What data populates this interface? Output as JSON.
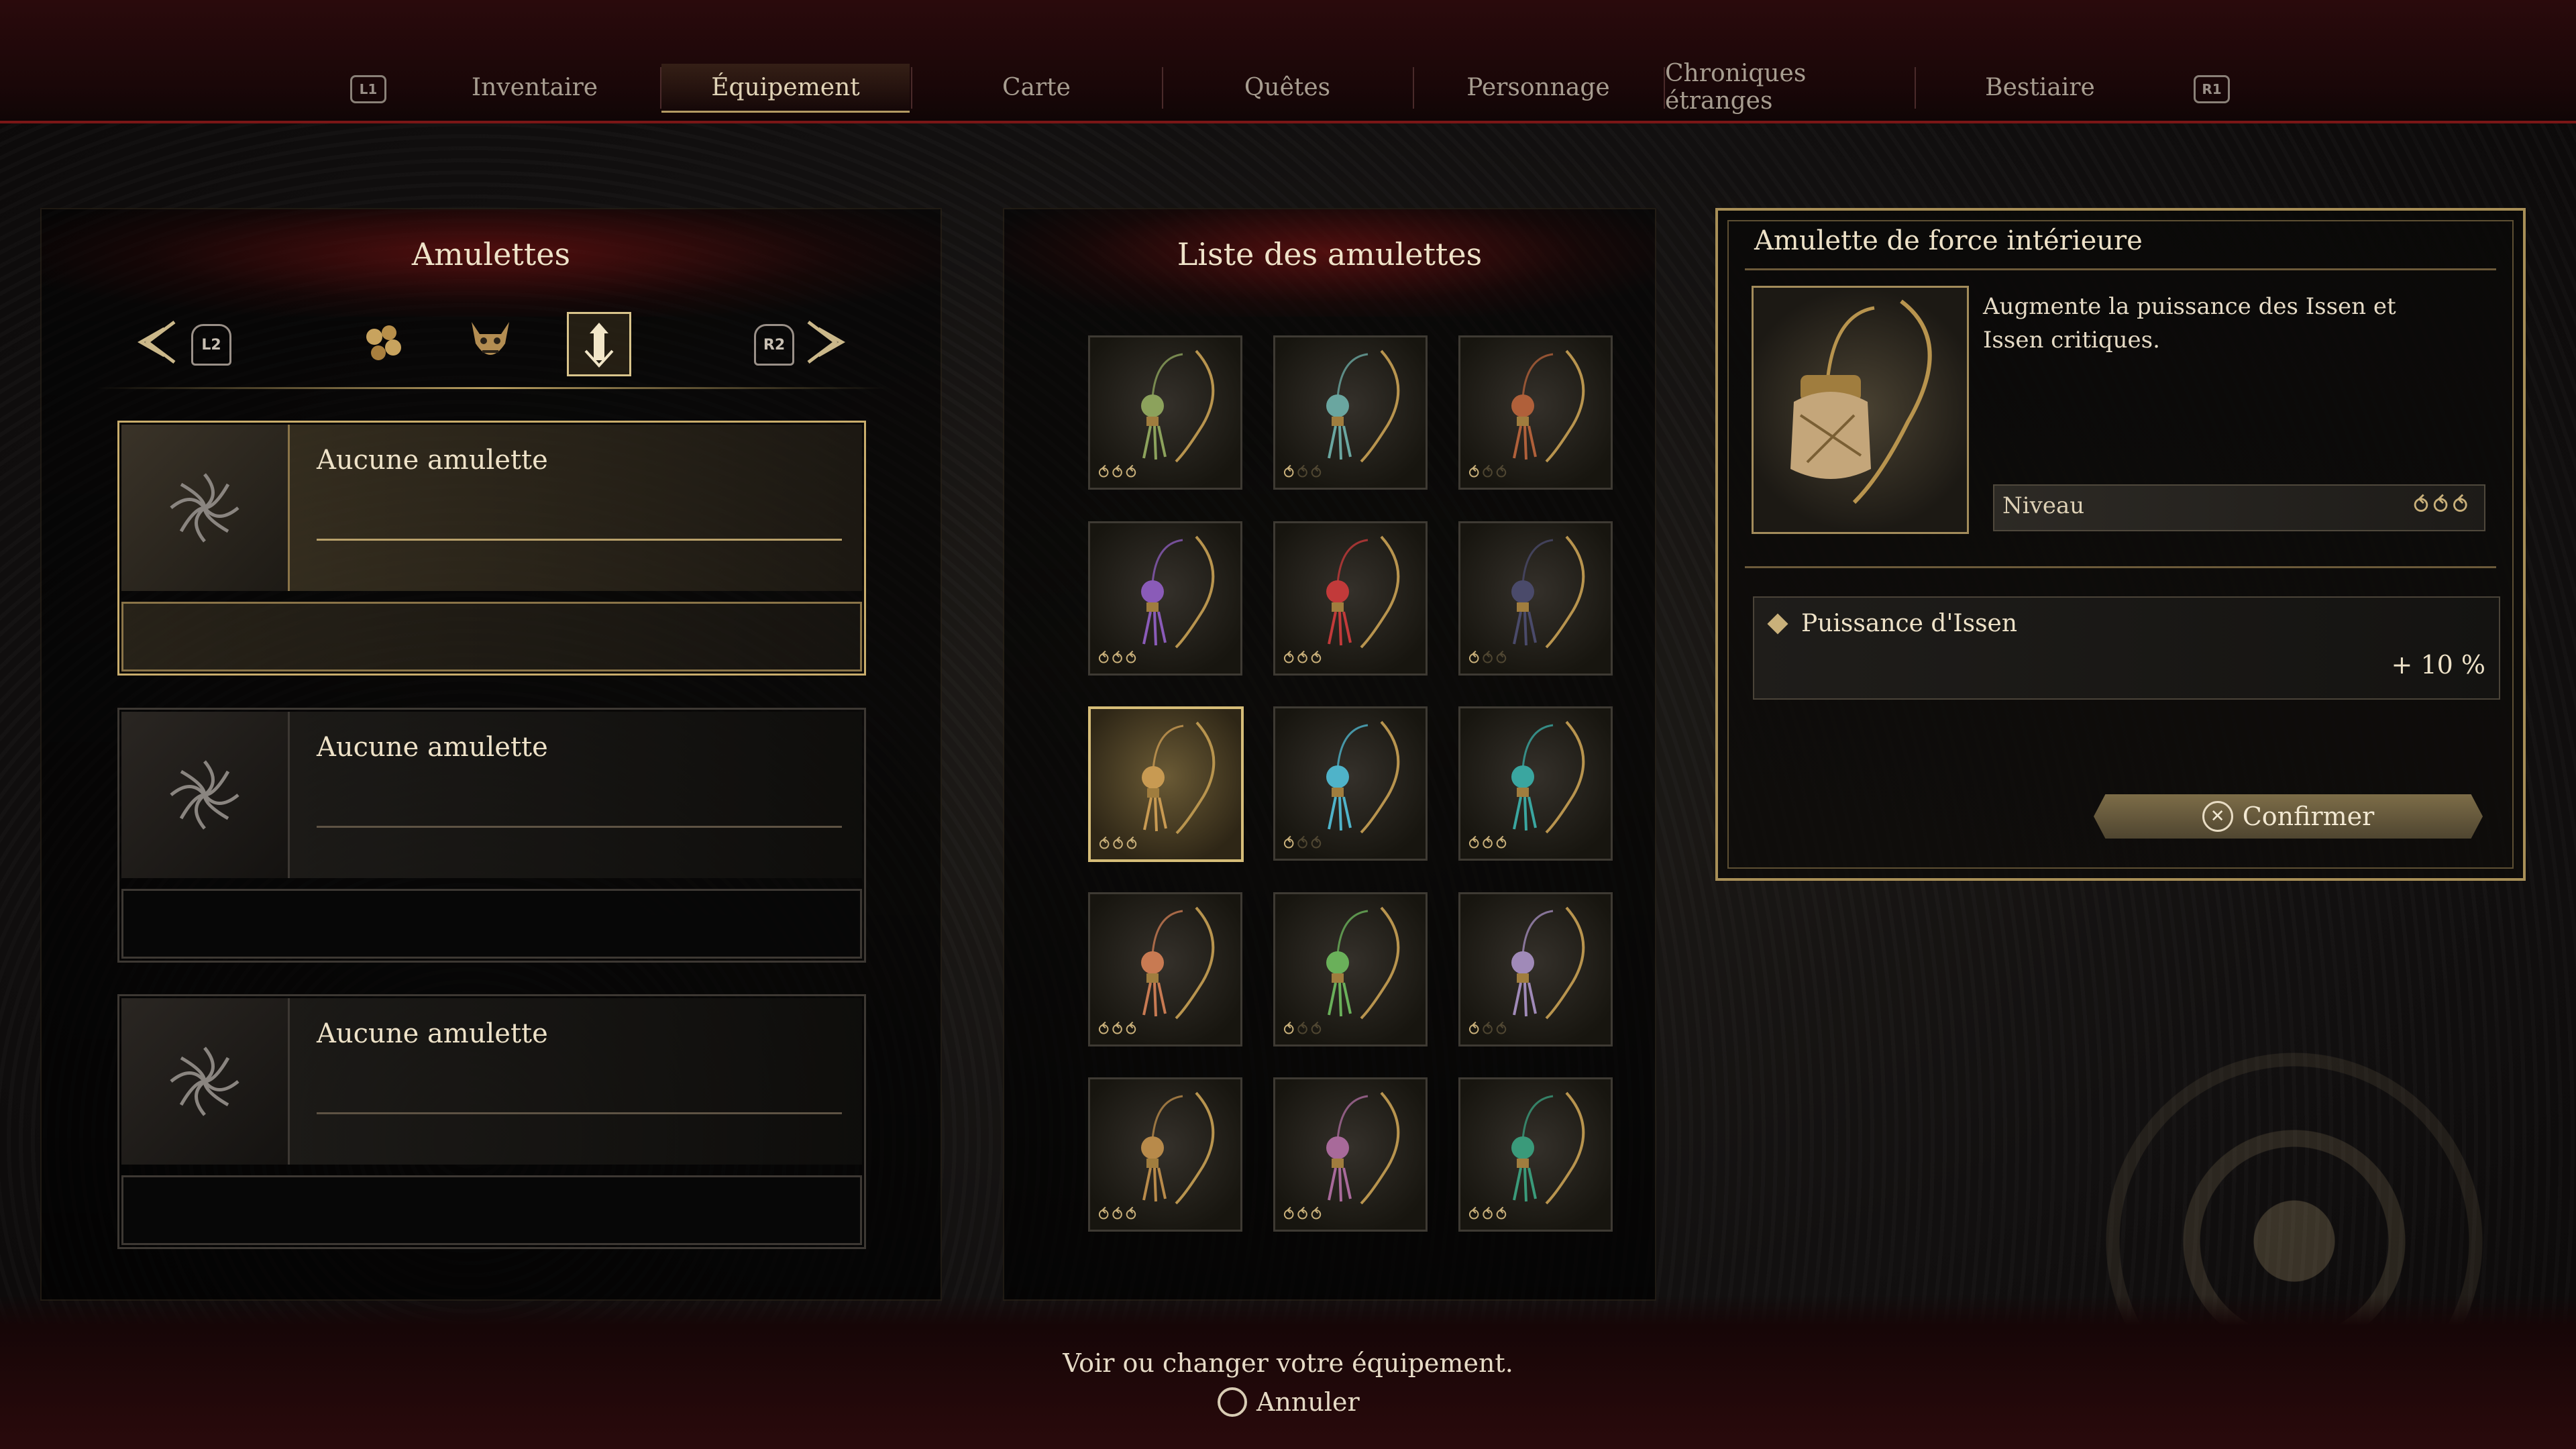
{
  "tabs": {
    "left_shoulder": "L1",
    "right_shoulder": "R1",
    "items": [
      {
        "label": "Inventaire"
      },
      {
        "label": "Équipement"
      },
      {
        "label": "Carte"
      },
      {
        "label": "Quêtes"
      },
      {
        "label": "Personnage"
      },
      {
        "label": "Chroniques étranges"
      },
      {
        "label": "Bestiaire"
      }
    ],
    "active_index": 1
  },
  "left_panel": {
    "title": "Amulettes",
    "prev_trigger": "L2",
    "next_trigger": "R2",
    "category_icons": [
      "beads-icon",
      "oni-mask-icon",
      "amulet-category-icon"
    ],
    "active_category_index": 2,
    "slots": [
      {
        "name": "Aucune amulette",
        "selected": true
      },
      {
        "name": "Aucune amulette",
        "selected": false
      },
      {
        "name": "Aucune amulette",
        "selected": false
      }
    ]
  },
  "center_panel": {
    "title": "Liste des amulettes",
    "selected_index": 6,
    "items": [
      {
        "icon": "amulet-icon",
        "color": "#8ca25c",
        "level": 3
      },
      {
        "icon": "amulet-icon",
        "color": "#6aa6a0",
        "level": 1
      },
      {
        "icon": "amulet-icon",
        "color": "#b0603a",
        "level": 1
      },
      {
        "icon": "amulet-icon",
        "color": "#8a5bb8",
        "level": 3
      },
      {
        "icon": "amulet-icon",
        "color": "#c23a3a",
        "level": 3
      },
      {
        "icon": "amulet-icon",
        "color": "#4a4a6a",
        "level": 1
      },
      {
        "icon": "amulet-icon",
        "color": "#c89a52",
        "level": 3
      },
      {
        "icon": "amulet-icon",
        "color": "#4fb3c9",
        "level": 1
      },
      {
        "icon": "amulet-icon",
        "color": "#3aa6a0",
        "level": 3
      },
      {
        "icon": "amulet-icon",
        "color": "#c87a52",
        "level": 3
      },
      {
        "icon": "amulet-icon",
        "color": "#6ab05a",
        "level": 1
      },
      {
        "icon": "amulet-icon",
        "color": "#a08ab8",
        "level": 1
      },
      {
        "icon": "amulet-icon",
        "color": "#b88a4a",
        "level": 3
      },
      {
        "icon": "amulet-icon",
        "color": "#a86a9a",
        "level": 3
      },
      {
        "icon": "amulet-icon",
        "color": "#3a9a7a",
        "level": 3
      }
    ]
  },
  "detail": {
    "title": "Amulette de force intérieure",
    "description": "Augmente la puissance des Issen et Issen critiques.",
    "level_label": "Niveau",
    "level": 3,
    "stat_name": "Puissance d'Issen",
    "stat_value": "+ 10 %",
    "confirm_label": "Confirmer"
  },
  "footer": {
    "hint": "Voir ou changer votre équipement.",
    "cancel_label": "Annuler"
  },
  "colors": {
    "accent_gold": "#c9ad6c",
    "blood_red": "#7a1616"
  }
}
